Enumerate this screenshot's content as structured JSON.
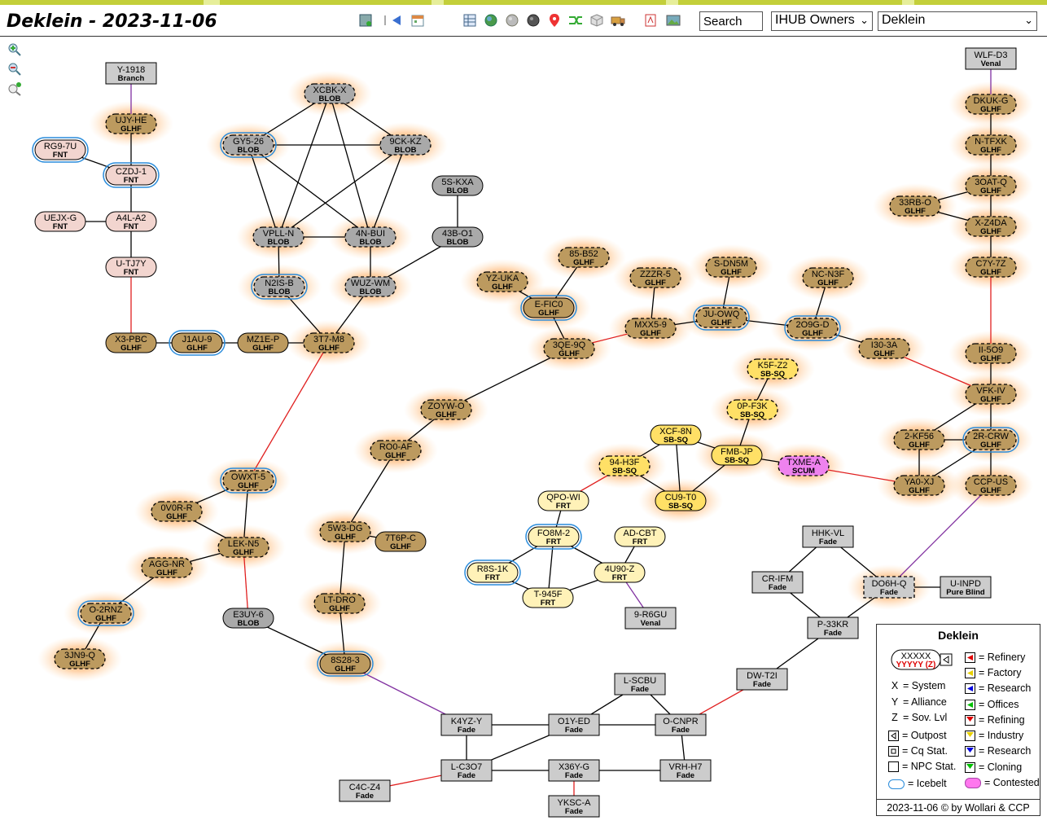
{
  "header": {
    "title": "Deklein - 2023-11-06",
    "search_value": "Search",
    "owner_select": "IHUB Owners",
    "region_select": "Deklein"
  },
  "toolbar_icons": [
    "report-icon",
    "back-arrow-icon",
    "calendar-icon",
    "table-icon",
    "globe-icon",
    "gray-globe-icon",
    "dark-globe-icon",
    "map-pin-icon",
    "shuffle-icon",
    "cube-icon",
    "truck-icon",
    "pdf-icon",
    "image-icon"
  ],
  "colors": {
    "GLHF": "#bc9a5f",
    "BLOB": "#a9a9a9",
    "FNT": "#f2d5cf",
    "Fade": "#cccccc",
    "FRT": "#fff2b8",
    "SB-SQ": "#ffe066",
    "SCUM": "#ee82ee",
    "glow": "#ffa64d",
    "icebelt": "#2a8cdb",
    "red_link": "#e02020",
    "purple_link": "#8030a0"
  },
  "systems": [
    {
      "id": "Y-1918",
      "alliance": "Branch",
      "shape": "rect"
    },
    {
      "id": "UJY-HE",
      "alliance": "GLHF",
      "glow": true,
      "dashed": true
    },
    {
      "id": "RG9-7U",
      "alliance": "FNT",
      "ice": true
    },
    {
      "id": "CZDJ-1",
      "alliance": "FNT",
      "ice": true
    },
    {
      "id": "UEJX-G",
      "alliance": "FNT"
    },
    {
      "id": "A4L-A2",
      "alliance": "FNT"
    },
    {
      "id": "U-TJ7Y",
      "alliance": "FNT"
    },
    {
      "id": "X3-PBC",
      "alliance": "GLHF"
    },
    {
      "id": "J1AU-9",
      "alliance": "GLHF",
      "ice": true
    },
    {
      "id": "MZ1E-P",
      "alliance": "GLHF"
    },
    {
      "id": "3T7-M8",
      "alliance": "GLHF",
      "glow": true,
      "dashed": true
    },
    {
      "id": "XCBK-X",
      "alliance": "BLOB",
      "glow": true,
      "dashed": true
    },
    {
      "id": "GY5-26",
      "alliance": "BLOB",
      "glow": true,
      "dashed": true,
      "ice": true
    },
    {
      "id": "9CK-KZ",
      "alliance": "BLOB",
      "glow": true,
      "dashed": true
    },
    {
      "id": "VPLL-N",
      "alliance": "BLOB",
      "glow": true,
      "dashed": true
    },
    {
      "id": "4N-BUI",
      "alliance": "BLOB",
      "glow": true,
      "dashed": true
    },
    {
      "id": "N2IS-B",
      "alliance": "BLOB",
      "glow": true,
      "dashed": true,
      "ice": true
    },
    {
      "id": "WUZ-WM",
      "alliance": "BLOB",
      "glow": true,
      "dashed": true
    },
    {
      "id": "5S-KXA",
      "alliance": "BLOB"
    },
    {
      "id": "43B-O1",
      "alliance": "BLOB"
    },
    {
      "id": "85-B52",
      "alliance": "GLHF",
      "glow": true,
      "dashed": true
    },
    {
      "id": "YZ-UKA",
      "alliance": "GLHF",
      "glow": true,
      "dashed": true
    },
    {
      "id": "E-FIC0",
      "alliance": "GLHF",
      "glow": true,
      "ice": true
    },
    {
      "id": "3QE-9Q",
      "alliance": "GLHF",
      "glow": true,
      "dashed": true
    },
    {
      "id": "ZZZR-5",
      "alliance": "GLHF",
      "glow": true,
      "dashed": true
    },
    {
      "id": "MXX5-9",
      "alliance": "GLHF",
      "glow": true,
      "dashed": true
    },
    {
      "id": "S-DN5M",
      "alliance": "GLHF",
      "glow": true,
      "dashed": true
    },
    {
      "id": "JU-OWQ",
      "alliance": "GLHF",
      "glow": true,
      "dashed": true,
      "ice": true
    },
    {
      "id": "NC-N3F",
      "alliance": "GLHF",
      "glow": true,
      "dashed": true
    },
    {
      "id": "2O9G-D",
      "alliance": "GLHF",
      "glow": true,
      "dashed": true,
      "ice": true
    },
    {
      "id": "I30-3A",
      "alliance": "GLHF",
      "glow": true,
      "dashed": true
    },
    {
      "id": "WLF-D3",
      "alliance": "Venal",
      "shape": "rect"
    },
    {
      "id": "DKUK-G",
      "alliance": "GLHF",
      "glow": true,
      "dashed": true
    },
    {
      "id": "N-TFXK",
      "alliance": "GLHF",
      "glow": true,
      "dashed": true
    },
    {
      "id": "3OAT-Q",
      "alliance": "GLHF",
      "glow": true,
      "dashed": true
    },
    {
      "id": "33RB-O",
      "alliance": "GLHF",
      "glow": true,
      "dashed": true
    },
    {
      "id": "X-Z4DA",
      "alliance": "GLHF",
      "glow": true,
      "dashed": true
    },
    {
      "id": "C7Y-7Z",
      "alliance": "GLHF",
      "glow": true,
      "dashed": true
    },
    {
      "id": "II-5O9",
      "alliance": "GLHF",
      "glow": true,
      "dashed": true
    },
    {
      "id": "VFK-IV",
      "alliance": "GLHF",
      "glow": true,
      "dashed": true
    },
    {
      "id": "2-KF56",
      "alliance": "GLHF",
      "glow": true,
      "dashed": true
    },
    {
      "id": "2R-CRW",
      "alliance": "GLHF",
      "glow": true,
      "dashed": true,
      "ice": true
    },
    {
      "id": "YA0-XJ",
      "alliance": "GLHF",
      "glow": true,
      "dashed": true
    },
    {
      "id": "CCP-US",
      "alliance": "GLHF",
      "glow": true,
      "dashed": true
    },
    {
      "id": "K5F-Z2",
      "alliance": "SB-SQ",
      "glow": true,
      "dashed": true
    },
    {
      "id": "0P-F3K",
      "alliance": "SB-SQ",
      "glow": true,
      "dashed": true
    },
    {
      "id": "XCF-8N",
      "alliance": "SB-SQ"
    },
    {
      "id": "FMB-JP",
      "alliance": "SB-SQ",
      "glow": true
    },
    {
      "id": "94-H3F",
      "alliance": "SB-SQ",
      "glow": true,
      "dashed": true
    },
    {
      "id": "CU9-T0",
      "alliance": "SB-SQ",
      "glow": true
    },
    {
      "id": "TXME-A",
      "alliance": "SCUM",
      "glow": true,
      "dashed": true
    },
    {
      "id": "ZOYW-O",
      "alliance": "GLHF",
      "glow": true,
      "dashed": true
    },
    {
      "id": "RO0-AF",
      "alliance": "GLHF",
      "glow": true,
      "dashed": true
    },
    {
      "id": "QPO-WI",
      "alliance": "FRT"
    },
    {
      "id": "FO8M-2",
      "alliance": "FRT",
      "ice": true
    },
    {
      "id": "AD-CBT",
      "alliance": "FRT"
    },
    {
      "id": "R8S-1K",
      "alliance": "FRT",
      "ice": true
    },
    {
      "id": "4U90-Z",
      "alliance": "FRT"
    },
    {
      "id": "T-945F",
      "alliance": "FRT"
    },
    {
      "id": "9-R6GU",
      "alliance": "Venal",
      "shape": "rect"
    },
    {
      "id": "OWXT-5",
      "alliance": "GLHF",
      "glow": true,
      "dashed": true,
      "ice": true
    },
    {
      "id": "0V0R-R",
      "alliance": "GLHF",
      "glow": true,
      "dashed": true
    },
    {
      "id": "LEK-N5",
      "alliance": "GLHF",
      "glow": true,
      "dashed": true
    },
    {
      "id": "AGG-NR",
      "alliance": "GLHF",
      "glow": true,
      "dashed": true
    },
    {
      "id": "O-2RNZ",
      "alliance": "GLHF",
      "glow": true,
      "dashed": true,
      "ice": true
    },
    {
      "id": "3JN9-Q",
      "alliance": "GLHF",
      "glow": true,
      "dashed": true
    },
    {
      "id": "E3UY-6",
      "alliance": "BLOB"
    },
    {
      "id": "5W3-DG",
      "alliance": "GLHF",
      "glow": true,
      "dashed": true
    },
    {
      "id": "7T6P-C",
      "alliance": "GLHF"
    },
    {
      "id": "LT-DRO",
      "alliance": "GLHF",
      "glow": true,
      "dashed": true
    },
    {
      "id": "8S28-3",
      "alliance": "GLHF",
      "glow": true,
      "ice": true
    },
    {
      "id": "HHK-VL",
      "alliance": "Fade",
      "shape": "rect"
    },
    {
      "id": "CR-IFM",
      "alliance": "Fade",
      "shape": "rect"
    },
    {
      "id": "DO6H-Q",
      "alliance": "Fade",
      "shape": "rect",
      "glow": true,
      "dashed": true
    },
    {
      "id": "U-INPD",
      "alliance": "Pure Blind",
      "shape": "rect"
    },
    {
      "id": "P-33KR",
      "alliance": "Fade",
      "shape": "rect"
    },
    {
      "id": "DW-T2I",
      "alliance": "Fade",
      "shape": "rect"
    },
    {
      "id": "L-SCBU",
      "alliance": "Fade",
      "shape": "rect"
    },
    {
      "id": "K4YZ-Y",
      "alliance": "Fade",
      "shape": "rect"
    },
    {
      "id": "O1Y-ED",
      "alliance": "Fade",
      "shape": "rect"
    },
    {
      "id": "O-CNPR",
      "alliance": "Fade",
      "shape": "rect"
    },
    {
      "id": "L-C3O7",
      "alliance": "Fade",
      "shape": "rect"
    },
    {
      "id": "X36Y-G",
      "alliance": "Fade",
      "shape": "rect"
    },
    {
      "id": "VRH-H7",
      "alliance": "Fade",
      "shape": "rect"
    },
    {
      "id": "C4C-Z4",
      "alliance": "Fade",
      "shape": "rect"
    },
    {
      "id": "YKSC-A",
      "alliance": "Fade",
      "shape": "rect"
    }
  ],
  "links": [
    {
      "a": "Y-1918",
      "b": "UJY-HE",
      "type": "region"
    },
    {
      "a": "UJY-HE",
      "b": "CZDJ-1"
    },
    {
      "a": "RG9-7U",
      "b": "CZDJ-1"
    },
    {
      "a": "CZDJ-1",
      "b": "A4L-A2"
    },
    {
      "a": "UEJX-G",
      "b": "A4L-A2"
    },
    {
      "a": "A4L-A2",
      "b": "U-TJ7Y"
    },
    {
      "a": "U-TJ7Y",
      "b": "X3-PBC",
      "type": "const"
    },
    {
      "a": "X3-PBC",
      "b": "J1AU-9"
    },
    {
      "a": "J1AU-9",
      "b": "MZ1E-P"
    },
    {
      "a": "MZ1E-P",
      "b": "3T7-M8"
    },
    {
      "a": "XCBK-X",
      "b": "GY5-26"
    },
    {
      "a": "XCBK-X",
      "b": "9CK-KZ"
    },
    {
      "a": "XCBK-X",
      "b": "VPLL-N"
    },
    {
      "a": "XCBK-X",
      "b": "4N-BUI"
    },
    {
      "a": "GY5-26",
      "b": "9CK-KZ"
    },
    {
      "a": "GY5-26",
      "b": "VPLL-N"
    },
    {
      "a": "GY5-26",
      "b": "4N-BUI"
    },
    {
      "a": "9CK-KZ",
      "b": "VPLL-N"
    },
    {
      "a": "9CK-KZ",
      "b": "4N-BUI"
    },
    {
      "a": "VPLL-N",
      "b": "4N-BUI"
    },
    {
      "a": "VPLL-N",
      "b": "N2IS-B"
    },
    {
      "a": "4N-BUI",
      "b": "WUZ-WM"
    },
    {
      "a": "5S-KXA",
      "b": "43B-O1"
    },
    {
      "a": "43B-O1",
      "b": "WUZ-WM"
    },
    {
      "a": "N2IS-B",
      "b": "3T7-M8"
    },
    {
      "a": "WUZ-WM",
      "b": "3T7-M8"
    },
    {
      "a": "3T7-M8",
      "b": "OWXT-5",
      "type": "const"
    },
    {
      "a": "85-B52",
      "b": "E-FIC0"
    },
    {
      "a": "YZ-UKA",
      "b": "E-FIC0"
    },
    {
      "a": "E-FIC0",
      "b": "3QE-9Q"
    },
    {
      "a": "3QE-9Q",
      "b": "MXX5-9",
      "type": "const"
    },
    {
      "a": "3QE-9Q",
      "b": "ZOYW-O"
    },
    {
      "a": "ZZZR-5",
      "b": "MXX5-9"
    },
    {
      "a": "MXX5-9",
      "b": "JU-OWQ"
    },
    {
      "a": "S-DN5M",
      "b": "JU-OWQ"
    },
    {
      "a": "JU-OWQ",
      "b": "2O9G-D"
    },
    {
      "a": "NC-N3F",
      "b": "2O9G-D"
    },
    {
      "a": "2O9G-D",
      "b": "I30-3A"
    },
    {
      "a": "I30-3A",
      "b": "VFK-IV",
      "type": "const"
    },
    {
      "a": "WLF-D3",
      "b": "DKUK-G",
      "type": "region"
    },
    {
      "a": "DKUK-G",
      "b": "N-TFXK"
    },
    {
      "a": "N-TFXK",
      "b": "3OAT-Q"
    },
    {
      "a": "3OAT-Q",
      "b": "33RB-O"
    },
    {
      "a": "3OAT-Q",
      "b": "X-Z4DA"
    },
    {
      "a": "33RB-O",
      "b": "X-Z4DA"
    },
    {
      "a": "X-Z4DA",
      "b": "C7Y-7Z"
    },
    {
      "a": "C7Y-7Z",
      "b": "II-5O9",
      "type": "const"
    },
    {
      "a": "II-5O9",
      "b": "VFK-IV"
    },
    {
      "a": "VFK-IV",
      "b": "2-KF56"
    },
    {
      "a": "VFK-IV",
      "b": "2R-CRW"
    },
    {
      "a": "2-KF56",
      "b": "2R-CRW"
    },
    {
      "a": "2-KF56",
      "b": "YA0-XJ"
    },
    {
      "a": "2R-CRW",
      "b": "YA0-XJ"
    },
    {
      "a": "2R-CRW",
      "b": "CCP-US"
    },
    {
      "a": "YA0-XJ",
      "b": "TXME-A",
      "type": "const"
    },
    {
      "a": "CCP-US",
      "b": "DO6H-Q",
      "type": "region"
    },
    {
      "a": "K5F-Z2",
      "b": "0P-F3K"
    },
    {
      "a": "0P-F3K",
      "b": "FMB-JP"
    },
    {
      "a": "XCF-8N",
      "b": "FMB-JP"
    },
    {
      "a": "XCF-8N",
      "b": "94-H3F"
    },
    {
      "a": "XCF-8N",
      "b": "CU9-T0"
    },
    {
      "a": "FMB-JP",
      "b": "CU9-T0"
    },
    {
      "a": "FMB-JP",
      "b": "TXME-A"
    },
    {
      "a": "94-H3F",
      "b": "CU9-T0"
    },
    {
      "a": "94-H3F",
      "b": "QPO-WI",
      "type": "const"
    },
    {
      "a": "ZOYW-O",
      "b": "RO0-AF"
    },
    {
      "a": "RO0-AF",
      "b": "5W3-DG"
    },
    {
      "a": "QPO-WI",
      "b": "FO8M-2"
    },
    {
      "a": "FO8M-2",
      "b": "R8S-1K"
    },
    {
      "a": "FO8M-2",
      "b": "T-945F"
    },
    {
      "a": "FO8M-2",
      "b": "4U90-Z"
    },
    {
      "a": "R8S-1K",
      "b": "T-945F"
    },
    {
      "a": "AD-CBT",
      "b": "4U90-Z"
    },
    {
      "a": "4U90-Z",
      "b": "T-945F"
    },
    {
      "a": "4U90-Z",
      "b": "9-R6GU",
      "type": "region"
    },
    {
      "a": "OWXT-5",
      "b": "0V0R-R"
    },
    {
      "a": "OWXT-5",
      "b": "LEK-N5"
    },
    {
      "a": "0V0R-R",
      "b": "LEK-N5"
    },
    {
      "a": "LEK-N5",
      "b": "AGG-NR"
    },
    {
      "a": "LEK-N5",
      "b": "E3UY-6",
      "type": "const"
    },
    {
      "a": "AGG-NR",
      "b": "O-2RNZ"
    },
    {
      "a": "O-2RNZ",
      "b": "3JN9-Q"
    },
    {
      "a": "E3UY-6",
      "b": "8S28-3"
    },
    {
      "a": "5W3-DG",
      "b": "7T6P-C"
    },
    {
      "a": "5W3-DG",
      "b": "LT-DRO"
    },
    {
      "a": "LT-DRO",
      "b": "8S28-3"
    },
    {
      "a": "8S28-3",
      "b": "K4YZ-Y",
      "type": "region"
    },
    {
      "a": "HHK-VL",
      "b": "CR-IFM"
    },
    {
      "a": "HHK-VL",
      "b": "DO6H-Q"
    },
    {
      "a": "CR-IFM",
      "b": "P-33KR"
    },
    {
      "a": "DO6H-Q",
      "b": "P-33KR"
    },
    {
      "a": "DO6H-Q",
      "b": "U-INPD"
    },
    {
      "a": "P-33KR",
      "b": "DW-T2I"
    },
    {
      "a": "DW-T2I",
      "b": "O-CNPR",
      "type": "const"
    },
    {
      "a": "L-SCBU",
      "b": "O1Y-ED"
    },
    {
      "a": "L-SCBU",
      "b": "O-CNPR"
    },
    {
      "a": "K4YZ-Y",
      "b": "O1Y-ED"
    },
    {
      "a": "K4YZ-Y",
      "b": "L-C3O7"
    },
    {
      "a": "O1Y-ED",
      "b": "O-CNPR"
    },
    {
      "a": "O1Y-ED",
      "b": "L-C3O7"
    },
    {
      "a": "O-CNPR",
      "b": "VRH-H7"
    },
    {
      "a": "L-C3O7",
      "b": "X36Y-G"
    },
    {
      "a": "X36Y-G",
      "b": "VRH-H7"
    },
    {
      "a": "X36Y-G",
      "b": "YKSC-A",
      "type": "const"
    },
    {
      "a": "L-C3O7",
      "b": "C4C-Z4",
      "type": "const"
    }
  ],
  "legend": {
    "title": "Deklein",
    "sample_name": "XXXXX",
    "sample_alliance": "YYYYY (Z)",
    "rows_left": [
      {
        "key": "X",
        "text": "= System"
      },
      {
        "key": "Y",
        "text": "= Alliance"
      },
      {
        "key": "Z",
        "text": "= Sov. Lvl"
      },
      {
        "key": "outpost",
        "text": "= Outpost"
      },
      {
        "key": "cq",
        "text": "= Cq Stat."
      },
      {
        "key": "npc",
        "text": "= NPC Stat."
      },
      {
        "key": "ice",
        "text": "= Icebelt"
      }
    ],
    "rows_right": [
      {
        "key": "refinery",
        "text": "= Refinery",
        "color": "#e00000"
      },
      {
        "key": "factory",
        "text": "= Factory",
        "color": "#e8d000"
      },
      {
        "key": "research",
        "text": "= Research",
        "color": "#0000e0"
      },
      {
        "key": "offices",
        "text": "= Offices",
        "color": "#00c000"
      },
      {
        "key": "refining",
        "text": "= Refining",
        "color": "#e00000"
      },
      {
        "key": "industry",
        "text": "= Industry",
        "color": "#e8d000"
      },
      {
        "key": "research2",
        "text": "= Research",
        "color": "#0000e0"
      },
      {
        "key": "cloning",
        "text": "= Cloning",
        "color": "#00c000"
      },
      {
        "key": "contested",
        "text": "= Contested",
        "color": "#ff77ee"
      }
    ],
    "footer": "2023-11-06 © by Wollari & CCP"
  }
}
